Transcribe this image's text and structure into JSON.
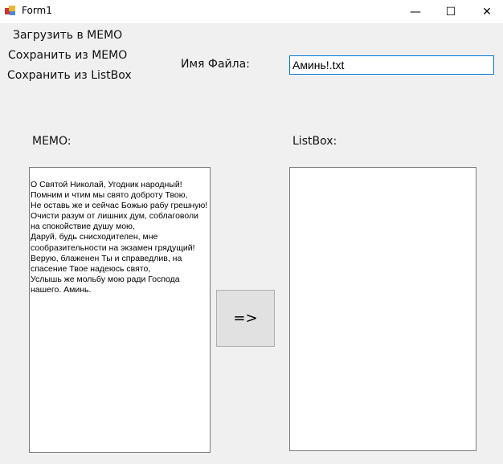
{
  "window": {
    "title": "Form1",
    "minimize": "—",
    "maximize": "☐",
    "close": "✕"
  },
  "menu": [
    "Загрузить в MEMO",
    "Сохранить из MEMO",
    "Сохранить из ListBox"
  ],
  "filename": {
    "label": "Имя Файла:",
    "value": "Аминь!.txt"
  },
  "memo": {
    "label": "MEMO:",
    "text": "О Святой Николай, Угодник народный!\nПомним и чтим мы свято доброту Твою,\nНе оставь же и сейчас Божью рабу грешную!\nОчисти разум от лишних дум, соблаговоли на спокойствие душу мою,\nДаруй, будь снисходителен, мне сообразительности на экзамен грядущий!\nВерую, блаженен Ты и справедлив, на спасение Твое надеюсь свято,\nУслышь же мольбу мою ради Господа нашего. Аминь."
  },
  "listbox": {
    "label": "ListBox:"
  },
  "transfer_button": "=>"
}
